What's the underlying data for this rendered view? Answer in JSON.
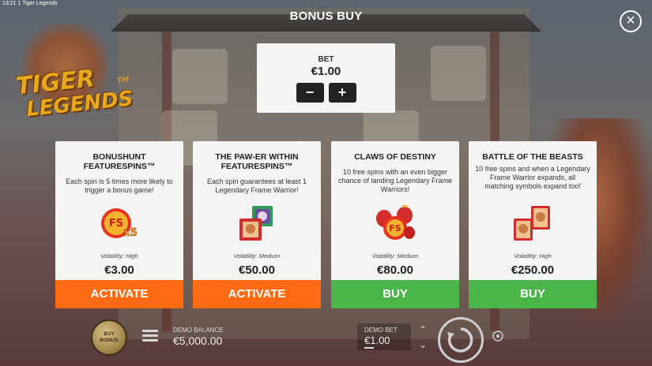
{
  "status_bar": {
    "text": "13:21  1 Tiger Legends"
  },
  "header": {
    "title": "BONUS BUY",
    "close_icon": "close-icon"
  },
  "logo": {
    "line1": "TIGER",
    "line2": "LEGENDS",
    "tm": "TM"
  },
  "bet_panel": {
    "label": "BET",
    "value": "€1.00",
    "minus_label": "−",
    "plus_label": "+"
  },
  "cards": [
    {
      "title": "BONUSHUNT FEATURESPINS™",
      "description": "Each spin is 5 times more likely to trigger a bonus game!",
      "icon": "fs-x5-icon",
      "volatility": "Volatility: High",
      "price": "€3.00",
      "action": "ACTIVATE",
      "action_color": "#ff6a13"
    },
    {
      "title": "THE PAW-ER WITHIN FEATURESPINS™",
      "description": "Each spin guarantees at least 1 Legendary Frame Warrior!",
      "icon": "frame-warrior-icon",
      "volatility": "Volatility: Medium",
      "price": "€50.00",
      "action": "ACTIVATE",
      "action_color": "#ff6a13"
    },
    {
      "title": "CLAWS OF DESTINY",
      "description": "10 free spins with an even bigger chance of landing Legendary Frame Warriors!",
      "icon": "fs-lanterns-icon",
      "volatility": "Volatility: Medium",
      "price": "€80.00",
      "action": "BUY",
      "action_color": "#4cb54a"
    },
    {
      "title": "BATTLE OF THE BEASTS",
      "description": "10 free spins and when a Legendary Frame Warrior expands, all matching symbols expand too!",
      "icon": "expanding-frame-icon",
      "volatility": "Volatility: High",
      "price": "€250.00",
      "action": "BUY",
      "action_color": "#4cb54a"
    }
  ],
  "footer": {
    "buy_bonus_line1": "BUY",
    "buy_bonus_line2": "BONUS",
    "demo_balance_label": "DEMO BALANCE",
    "demo_balance_value": "€5,000.00",
    "demo_bet_label": "DEMO BET",
    "demo_bet_value": "€1.00",
    "up_arrow": "⌃",
    "down_arrow": "⌄"
  }
}
